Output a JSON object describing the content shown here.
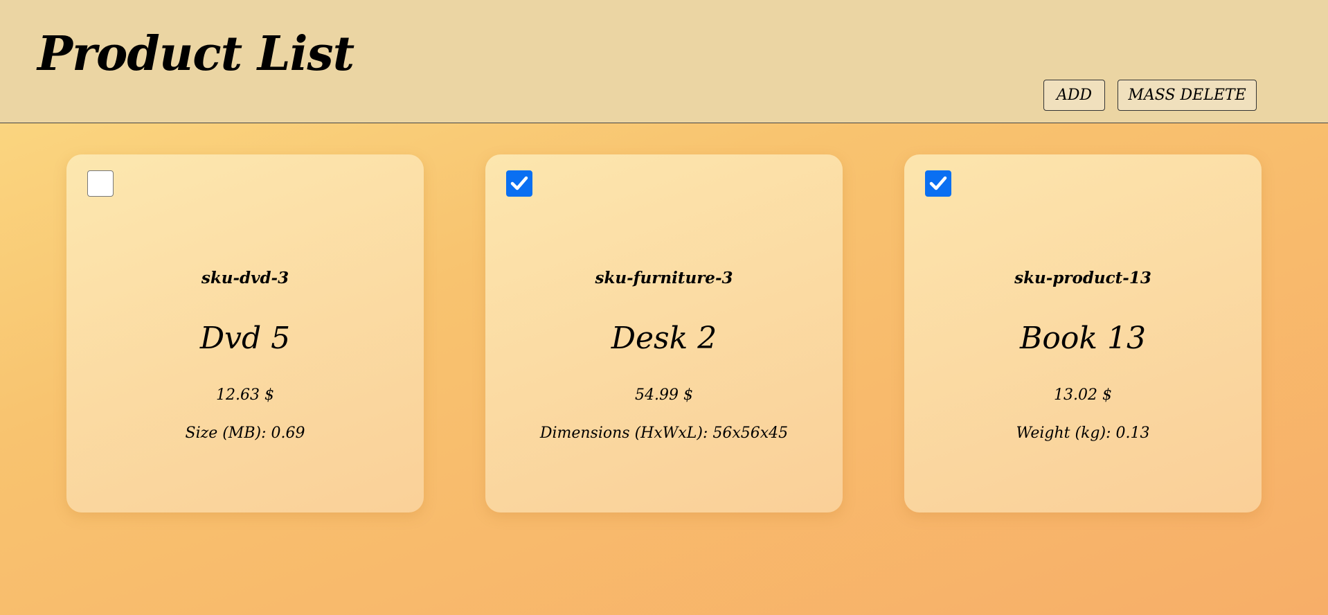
{
  "header": {
    "title": "Product List",
    "add_label": "ADD",
    "mass_delete_label": "MASS DELETE"
  },
  "products": [
    {
      "checked": false,
      "sku": "sku-dvd-3",
      "name": "Dvd 5",
      "price": "12.63 $",
      "attribute": "Size (MB): 0.69"
    },
    {
      "checked": true,
      "sku": "sku-furniture-3",
      "name": "Desk 2",
      "price": "54.99 $",
      "attribute": "Dimensions (HxWxL): 56x56x45"
    },
    {
      "checked": true,
      "sku": "sku-product-13",
      "name": "Book 13",
      "price": "13.02 $",
      "attribute": "Weight (kg): 0.13"
    }
  ],
  "colors": {
    "header_bg": "#ebd5a3",
    "checkbox_checked": "#0a6ff2"
  }
}
